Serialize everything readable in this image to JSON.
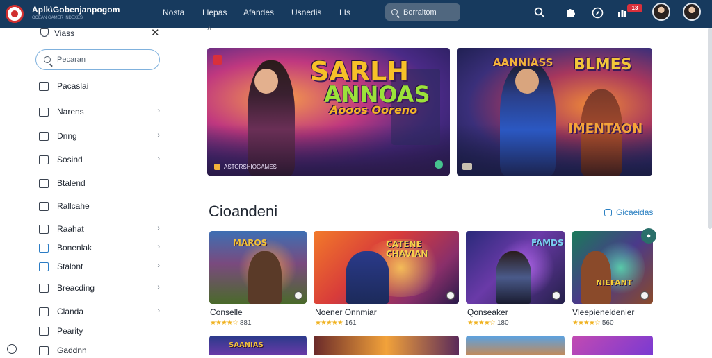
{
  "header": {
    "brand_title": "Aplk\\Gobenjanpogom",
    "brand_subtitle": "OCEAN GAMER INDEXES",
    "nav": [
      "Nosta",
      "Llepas",
      "Afandes",
      "Usnedis",
      "LIs"
    ],
    "search_placeholder": "Borraltom",
    "notification_count": "13"
  },
  "sidebar": {
    "heading": "Viass",
    "search_placeholder": "Pecaran",
    "items": [
      {
        "label": "Pacaslai",
        "chevron": false
      },
      {
        "label": "Narens",
        "chevron": true
      },
      {
        "label": "Dnng",
        "chevron": true
      },
      {
        "label": "Sosind",
        "chevron": true
      },
      {
        "label": "Btalend",
        "chevron": false
      },
      {
        "label": "Rallcahe",
        "chevron": false
      },
      {
        "label": "Raahat",
        "chevron": true
      },
      {
        "label": "Bonenlak",
        "chevron": true
      },
      {
        "label": "Stalont",
        "chevron": true
      },
      {
        "label": "Breacding",
        "chevron": true
      },
      {
        "label": "Clanda",
        "chevron": true
      },
      {
        "label": "Pearity",
        "chevron": false
      },
      {
        "label": "Gaddnn",
        "chevron": false
      }
    ]
  },
  "hero": [
    {
      "title_line1": "SARLH",
      "title_line2": "ANNOAS",
      "title_line3": "Aooos Ooreno",
      "caption": "ASTORSHIOGAMES"
    },
    {
      "title_line1": "AANNIASS",
      "title_line2": "BLMES",
      "title_line3": "IMENTAON",
      "caption": ""
    }
  ],
  "section": {
    "title": "Cioandeni",
    "link": "Gicaeidas"
  },
  "cards": [
    {
      "art_title": "MAROS",
      "name": "Conselle",
      "rating": "881",
      "stars": "★★★★☆"
    },
    {
      "art_title": "CATENE CHAVIAN",
      "name": "Noener Onnmiar",
      "rating": "161",
      "stars": "★★★★★"
    },
    {
      "art_title": "FAMDS",
      "name": "Qonseaker",
      "rating": "180",
      "stars": "★★★★☆"
    },
    {
      "art_title": "NIEFANT",
      "name": "Vleepieneldenier",
      "rating": "560",
      "stars": "★★★★☆"
    }
  ],
  "row2": [
    {
      "art_title": "SAANIAS"
    },
    {
      "art_title": ""
    },
    {
      "art_title": ""
    },
    {
      "art_title": ""
    }
  ]
}
